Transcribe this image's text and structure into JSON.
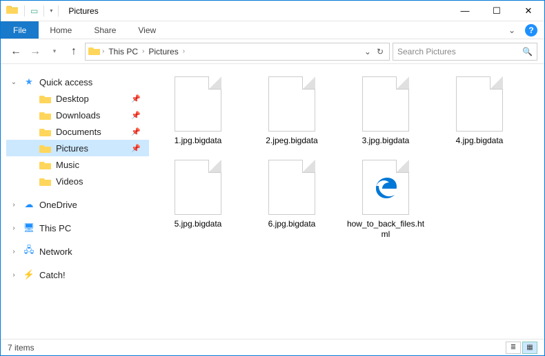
{
  "window": {
    "title": "Pictures"
  },
  "ribbon": {
    "file": "File",
    "tabs": [
      "Home",
      "Share",
      "View"
    ]
  },
  "breadcrumb": {
    "parts": [
      "This PC",
      "Pictures"
    ]
  },
  "search": {
    "placeholder": "Search Pictures"
  },
  "sidebar": {
    "quick_access": {
      "label": "Quick access",
      "items": [
        {
          "label": "Desktop",
          "pinned": true
        },
        {
          "label": "Downloads",
          "pinned": true
        },
        {
          "label": "Documents",
          "pinned": true
        },
        {
          "label": "Pictures",
          "pinned": true,
          "selected": true
        },
        {
          "label": "Music",
          "pinned": false
        },
        {
          "label": "Videos",
          "pinned": false
        }
      ]
    },
    "roots": [
      {
        "label": "OneDrive"
      },
      {
        "label": "This PC"
      },
      {
        "label": "Network"
      },
      {
        "label": "Catch!"
      }
    ]
  },
  "files": [
    {
      "name": "1.jpg.bigdata",
      "kind": "blank"
    },
    {
      "name": "2.jpeg.bigdata",
      "kind": "blank"
    },
    {
      "name": "3.jpg.bigdata",
      "kind": "blank"
    },
    {
      "name": "4.jpg.bigdata",
      "kind": "blank"
    },
    {
      "name": "5.jpg.bigdata",
      "kind": "blank"
    },
    {
      "name": "6.jpg.bigdata",
      "kind": "blank"
    },
    {
      "name": "how_to_back_files.html",
      "kind": "edge"
    }
  ],
  "status": {
    "count": "7 items"
  }
}
